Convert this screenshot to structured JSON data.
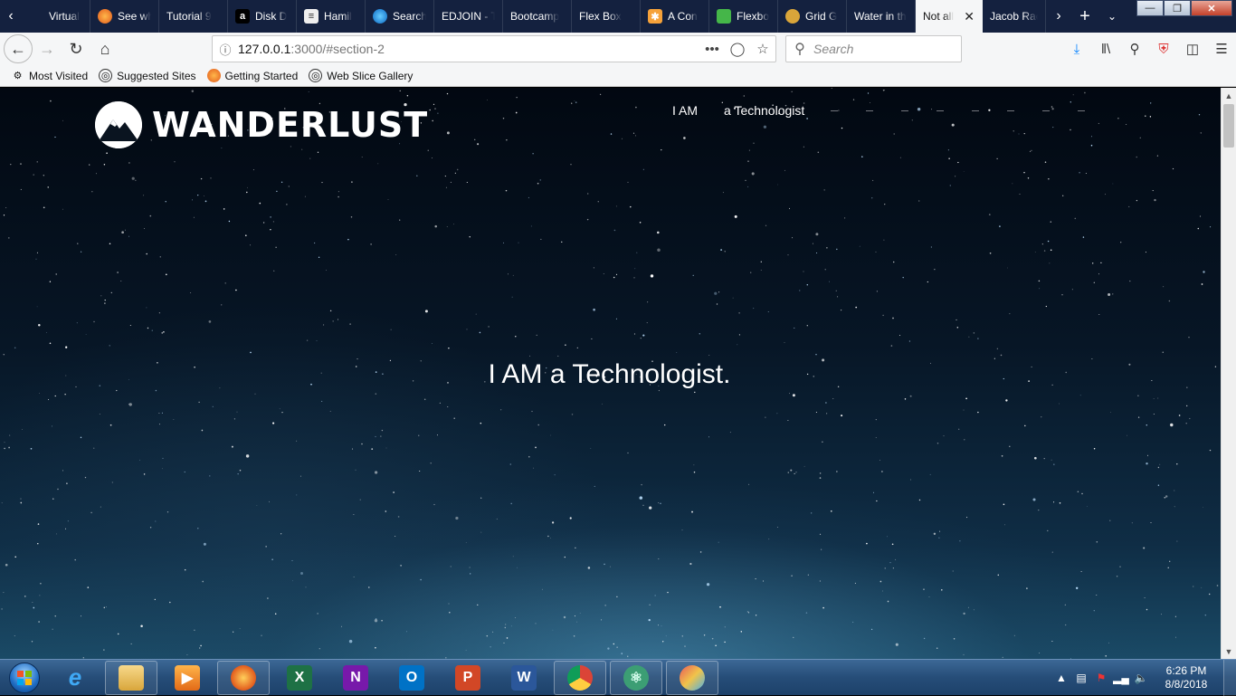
{
  "browser": {
    "tabs": [
      {
        "title": "Virtual",
        "icon": "generic-page-icon"
      },
      {
        "title": "See wh",
        "icon": "firefox-icon"
      },
      {
        "title": "Tutorial 9",
        "icon": ""
      },
      {
        "title": "Disk D",
        "icon": "amazon-icon"
      },
      {
        "title": "Hamil",
        "icon": "document-icon"
      },
      {
        "title": "Search",
        "icon": "edge-icon"
      },
      {
        "title": "EDJOIN - T",
        "icon": ""
      },
      {
        "title": "Bootcamp",
        "icon": ""
      },
      {
        "title": "Flex Box",
        "icon": ""
      },
      {
        "title": "A Con",
        "icon": "star-burst-icon"
      },
      {
        "title": "Flexbo",
        "icon": "frog-icon"
      },
      {
        "title": "Grid G",
        "icon": "fruit-icon"
      },
      {
        "title": "Water in th",
        "icon": ""
      },
      {
        "title": "Not all",
        "icon": "",
        "active": true
      },
      {
        "title": "Jacob Rack",
        "icon": ""
      }
    ],
    "url_host": "127.0.0.1",
    "url_path": ":3000/#section-2",
    "search_placeholder": "Search",
    "bookmarks": [
      {
        "label": "Most Visited",
        "icon": "gear-icon"
      },
      {
        "label": "Suggested Sites",
        "icon": "globe-icon"
      },
      {
        "label": "Getting Started",
        "icon": "firefox-icon"
      },
      {
        "label": "Web Slice Gallery",
        "icon": "globe-icon"
      }
    ]
  },
  "page": {
    "logo_text": "WANDERLUST",
    "nav": [
      "I AM",
      "a Technologist"
    ],
    "nav_dash_count": 9,
    "hero_text": "I AM a Technologist."
  },
  "taskbar": {
    "apps": [
      "internet-explorer",
      "file-explorer",
      "media-player",
      "firefox",
      "excel",
      "onenote",
      "outlook",
      "powerpoint",
      "word",
      "chrome",
      "atom",
      "paint"
    ],
    "time": "6:26 PM",
    "date": "8/8/2018"
  },
  "colors": {
    "tabstrip": "#14213f",
    "toolbar": "#f5f6f7",
    "taskbar": "#264d78"
  }
}
